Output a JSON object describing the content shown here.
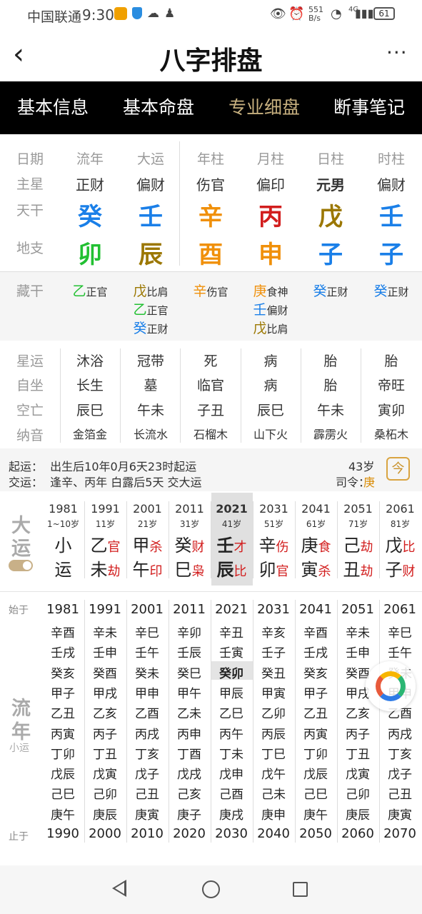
{
  "status": {
    "carrier": "中国联通",
    "time": "9:30",
    "speed": "551\nB/s",
    "net": "4G",
    "battery": "61"
  },
  "nav": {
    "title": "八字排盘",
    "back": "‹",
    "more": "···"
  },
  "tabs": [
    "基本信息",
    "基本命盘",
    "专业细盘",
    "断事笔记"
  ],
  "pillars": {
    "row_labels": [
      "日期",
      "主星",
      "天干",
      "地支"
    ],
    "cols": [
      {
        "head": "流年",
        "star": "正财",
        "gan": "癸",
        "gan_color": "blue",
        "zhi": "卯",
        "zhi_color": "green"
      },
      {
        "head": "大运",
        "star": "偏财",
        "gan": "壬",
        "gan_color": "blue",
        "zhi": "辰",
        "zhi_color": "brown"
      },
      {
        "head": "年柱",
        "star": "伤官",
        "gan": "辛",
        "gan_color": "orange",
        "zhi": "酉",
        "zhi_color": "orange"
      },
      {
        "head": "月柱",
        "star": "偏印",
        "gan": "丙",
        "gan_color": "red",
        "zhi": "申",
        "zhi_color": "orange"
      },
      {
        "head": "日柱",
        "star": "元男",
        "gan": "戊",
        "gan_color": "brown",
        "zhi": "子",
        "zhi_color": "blue"
      },
      {
        "head": "时柱",
        "star": "偏财",
        "gan": "壬",
        "gan_color": "blue",
        "zhi": "子",
        "zhi_color": "blue"
      }
    ]
  },
  "canggan": {
    "label": "藏干",
    "cols": [
      [
        {
          "g": "乙",
          "c": "green",
          "s": "正官"
        }
      ],
      [
        {
          "g": "戊",
          "c": "brown",
          "s": "比肩"
        },
        {
          "g": "乙",
          "c": "green",
          "s": "正官"
        },
        {
          "g": "癸",
          "c": "blue",
          "s": "正财"
        }
      ],
      [
        {
          "g": "辛",
          "c": "orange",
          "s": "伤官"
        }
      ],
      [
        {
          "g": "庚",
          "c": "orange",
          "s": "食神"
        },
        {
          "g": "壬",
          "c": "blue",
          "s": "偏财"
        },
        {
          "g": "戊",
          "c": "brown",
          "s": "比肩"
        }
      ],
      [
        {
          "g": "癸",
          "c": "blue",
          "s": "正财"
        }
      ],
      [
        {
          "g": "癸",
          "c": "blue",
          "s": "正财"
        }
      ]
    ]
  },
  "info_rows": {
    "labels": [
      "星运",
      "自坐",
      "空亡",
      "纳音"
    ],
    "cols": [
      [
        "沐浴",
        "长生",
        "辰巳",
        "金箔金"
      ],
      [
        "冠带",
        "墓",
        "午未",
        "长流水"
      ],
      [
        "死",
        "临官",
        "子丑",
        "石榴木"
      ],
      [
        "病",
        "病",
        "辰巳",
        "山下火"
      ],
      [
        "胎",
        "胎",
        "午未",
        "霹雳火"
      ],
      [
        "胎",
        "帝旺",
        "寅卯",
        "桑柘木"
      ]
    ]
  },
  "qiyun": {
    "l1": "起运：  出生后10年0月6天23时起运",
    "l2": "交运：  逢辛、丙年 白露后5天 交大运",
    "age": "43岁",
    "siling_label": "司令：",
    "siling_val": "庚",
    "icon": "今"
  },
  "dayun": {
    "title1": "大",
    "title2": "运",
    "cols": [
      {
        "year": "1981",
        "age": "1~10岁",
        "g": "小",
        "z": "运",
        "gs": "",
        "zs": ""
      },
      {
        "year": "1991",
        "age": "11岁",
        "g": "乙",
        "z": "未",
        "gs": "官",
        "zs": "劫"
      },
      {
        "year": "2001",
        "age": "21岁",
        "g": "甲",
        "z": "午",
        "gs": "杀",
        "zs": "印"
      },
      {
        "year": "2011",
        "age": "31岁",
        "g": "癸",
        "z": "巳",
        "gs": "财",
        "zs": "枭"
      },
      {
        "year": "2021",
        "age": "41岁",
        "g": "壬",
        "z": "辰",
        "gs": "才",
        "zs": "比"
      },
      {
        "year": "2031",
        "age": "51岁",
        "g": "辛",
        "z": "卯",
        "gs": "伤",
        "zs": "官"
      },
      {
        "year": "2041",
        "age": "61岁",
        "g": "庚",
        "z": "寅",
        "gs": "食",
        "zs": "杀"
      },
      {
        "year": "2051",
        "age": "71岁",
        "g": "己",
        "z": "丑",
        "gs": "劫",
        "zs": "劫"
      },
      {
        "year": "2061",
        "age": "81岁",
        "g": "戊",
        "z": "子",
        "gs": "比",
        "zs": "财"
      }
    ]
  },
  "liunian": {
    "start_label": "始于",
    "end_label": "止于",
    "title1": "流",
    "title2": "年",
    "sub": "小运",
    "cols": [
      {
        "start": "1981",
        "end": "1990",
        "items": [
          "辛酉",
          "壬戌",
          "癸亥",
          "甲子",
          "乙丑",
          "丙寅",
          "丁卯",
          "戊辰",
          "己巳",
          "庚午"
        ]
      },
      {
        "start": "1991",
        "end": "2000",
        "items": [
          "辛未",
          "壬申",
          "癸酉",
          "甲戌",
          "乙亥",
          "丙子",
          "丁丑",
          "戊寅",
          "己卯",
          "庚辰"
        ]
      },
      {
        "start": "2001",
        "end": "2010",
        "items": [
          "辛巳",
          "壬午",
          "癸未",
          "甲申",
          "乙酉",
          "丙戌",
          "丁亥",
          "戊子",
          "己丑",
          "庚寅"
        ]
      },
      {
        "start": "2011",
        "end": "2020",
        "items": [
          "辛卯",
          "壬辰",
          "癸巳",
          "甲午",
          "乙未",
          "丙申",
          "丁酉",
          "戊戌",
          "己亥",
          "庚子"
        ]
      },
      {
        "start": "2021",
        "end": "2030",
        "items": [
          "辛丑",
          "壬寅",
          "癸卯",
          "甲辰",
          "乙巳",
          "丙午",
          "丁未",
          "戊申",
          "己酉",
          "庚戌"
        ]
      },
      {
        "start": "2031",
        "end": "2040",
        "items": [
          "辛亥",
          "壬子",
          "癸丑",
          "甲寅",
          "乙卯",
          "丙辰",
          "丁巳",
          "戊午",
          "己未",
          "庚申"
        ]
      },
      {
        "start": "2041",
        "end": "2050",
        "items": [
          "辛酉",
          "壬戌",
          "癸亥",
          "甲子",
          "乙丑",
          "丙寅",
          "丁卯",
          "戊辰",
          "己巳",
          "庚午"
        ]
      },
      {
        "start": "2051",
        "end": "2060",
        "items": [
          "辛未",
          "壬申",
          "癸酉",
          "甲戌",
          "乙亥",
          "丙子",
          "丁丑",
          "戊寅",
          "己卯",
          "庚辰"
        ]
      },
      {
        "start": "2061",
        "end": "2070",
        "items": [
          "辛巳",
          "壬午",
          "癸未",
          "甲申",
          "乙酉",
          "丙戌",
          "丁亥",
          "戊子",
          "己丑",
          "庚寅"
        ]
      }
    ]
  }
}
